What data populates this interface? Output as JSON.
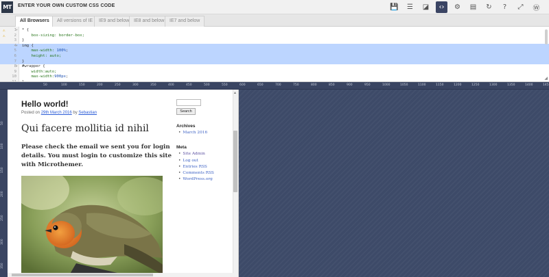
{
  "app": {
    "logo_text": "MT",
    "title": "ENTER YOUR OWN CUSTOM CSS CODE"
  },
  "toolbar": [
    {
      "name": "save-icon",
      "glyph": "💾"
    },
    {
      "name": "layout-icon",
      "glyph": "☰"
    },
    {
      "name": "edit-icon",
      "glyph": "◪"
    },
    {
      "name": "code-icon",
      "glyph": "‹›"
    },
    {
      "name": "gear-icon",
      "glyph": "⚙"
    },
    {
      "name": "monitor-icon",
      "glyph": "▤"
    },
    {
      "name": "refresh-icon",
      "glyph": "↻"
    },
    {
      "name": "help-icon",
      "glyph": "?"
    },
    {
      "name": "expand-icon",
      "glyph": "⤢"
    },
    {
      "name": "wordpress-icon",
      "glyph": "Ⓦ"
    }
  ],
  "tabs": [
    "All Browsers",
    "All versions of IE",
    "IE9 and below",
    "IE8 and below",
    "IE7 and below"
  ],
  "editor": {
    "lines": [
      {
        "n": "1",
        "html": "<span class='k-sel'>* {</span>",
        "warn": true,
        "fold": true
      },
      {
        "n": "2",
        "html": "    <span class='k-green'>box-sizing: border-box;</span>",
        "warn": true
      },
      {
        "n": "3",
        "html": "<span class='k-sel'>}</span>"
      },
      {
        "n": "4",
        "html": "<span class='k-sel'>img {</span>",
        "hl": true,
        "fold": true
      },
      {
        "n": "5",
        "html": "    <span class='k-green'>max-width:</span> <span class='k-val'>100%</span>;",
        "hl": true
      },
      {
        "n": "6",
        "html": "    <span class='k-green'>height: auto;</span>",
        "hl": true
      },
      {
        "n": "7",
        "html": "<span class='k-sel'>}</span>",
        "hl": true
      },
      {
        "n": "8",
        "html": "<span class='k-sel'>#wrapper {</span>",
        "fold": true
      },
      {
        "n": "9",
        "html": "    <span class='k-green'>width:auto;</span>"
      },
      {
        "n": "10",
        "html": "    <span class='k-green'>max-width:</span><span class='k-val'>900px</span>;"
      },
      {
        "n": "11",
        "html": "<span class='k-sel'>}</span>"
      }
    ]
  },
  "ruler": {
    "ticks": [
      "50",
      "100",
      "150",
      "200",
      "250",
      "300",
      "350",
      "400",
      "450",
      "500",
      "550",
      "600",
      "650",
      "700",
      "750",
      "800",
      "850",
      "900",
      "950",
      "1000",
      "1050",
      "1100",
      "1150",
      "1200",
      "1250",
      "1300",
      "1350",
      "1400",
      "1450"
    ],
    "left_ticks": [
      "50",
      "100",
      "150",
      "200",
      "250",
      "300",
      "350"
    ]
  },
  "preview": {
    "post_title": "Hello world!",
    "meta_prefix": "Posted on",
    "meta_date": "29th March 2016",
    "meta_by": "by",
    "meta_author": "Sebastian",
    "heading": "Qui facere mollitia id nihil",
    "notice": "Please check the email we sent you for login details. You must login to customize this site with Microthemer.",
    "search_button": "Search",
    "archives_title": "Archives",
    "archives": [
      "March 2016"
    ],
    "meta_title": "Meta",
    "meta_links": [
      "Site Admin",
      "Log out",
      "Entries RSS",
      "Comments RSS",
      "WordPress.org"
    ]
  }
}
